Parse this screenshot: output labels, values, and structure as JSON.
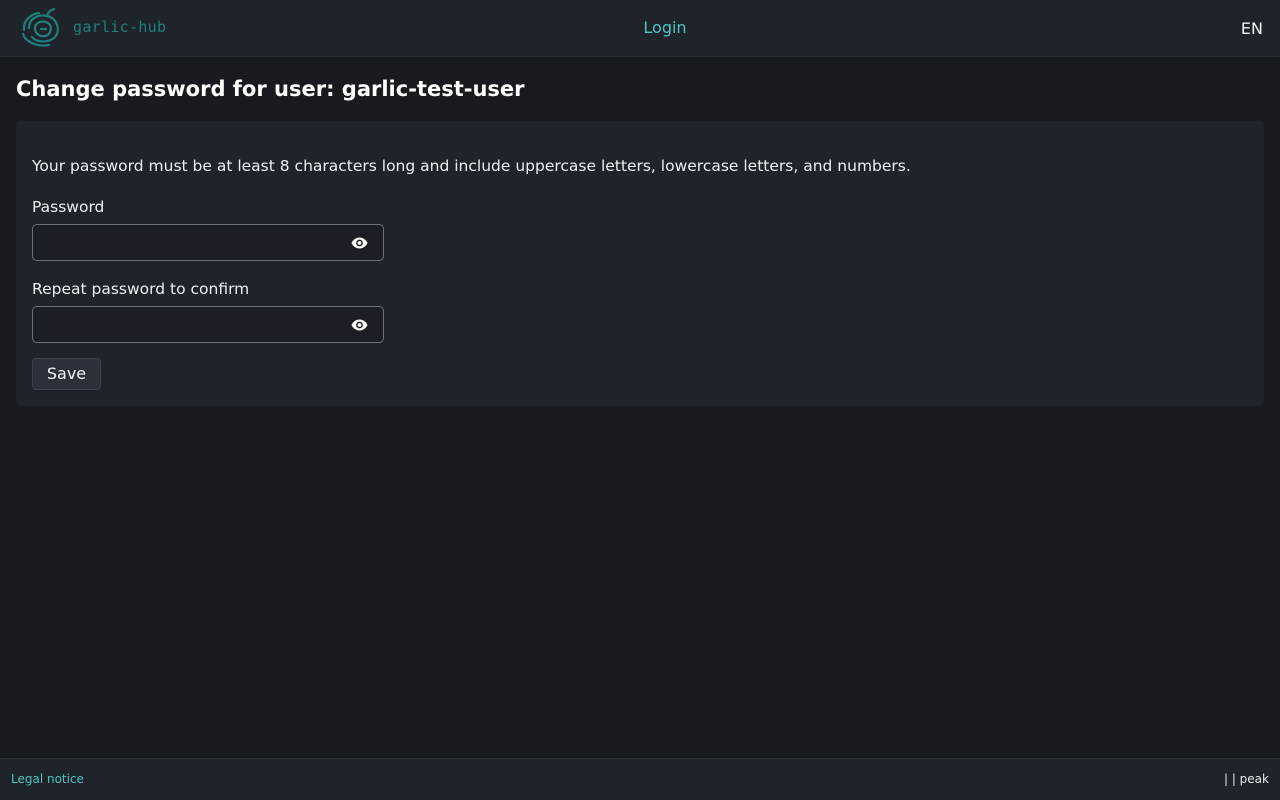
{
  "header": {
    "logo_text": "garlic-hub",
    "login_label": "Login",
    "language": "EN"
  },
  "page": {
    "title": "Change password for user: garlic-test-user"
  },
  "form": {
    "hint": "Your password must be at least 8 characters long and include uppercase letters, lowercase letters, and numbers.",
    "password_label": "Password",
    "password_value": "",
    "confirm_label": "Repeat password to confirm",
    "confirm_value": "",
    "save_label": "Save"
  },
  "footer": {
    "legal_label": "Legal notice",
    "version_text": "| | peak"
  },
  "colors": {
    "accent": "#4fc3c0",
    "logo": "#1f7f7c",
    "background": "#171a1f",
    "panel": "#1f232a"
  },
  "icons": {
    "logo": "garlic-logo-icon",
    "password_toggle": "eye-icon"
  }
}
